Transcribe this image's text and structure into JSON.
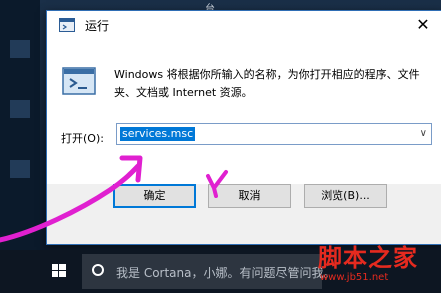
{
  "desktop": {
    "top_fragment": "台"
  },
  "dialog": {
    "title": "运行",
    "close_glyph": "✕",
    "description": "Windows 将根据你所输入的名称，为你打开相应的程序、文件夹、文档或 Internet 资源。",
    "open_label": "打开(O):",
    "open_value": "services.msc",
    "dropdown_glyph": "∨",
    "buttons": {
      "ok": "确定",
      "cancel": "取消",
      "browse": "浏览(B)..."
    }
  },
  "taskbar": {
    "search_text": "我是 Cortana，小娜。有问题尽管问我。"
  },
  "watermark": {
    "main": "脚本之家",
    "sub": "www.jb51.net"
  },
  "annotation": {
    "color": "#e020d0"
  }
}
